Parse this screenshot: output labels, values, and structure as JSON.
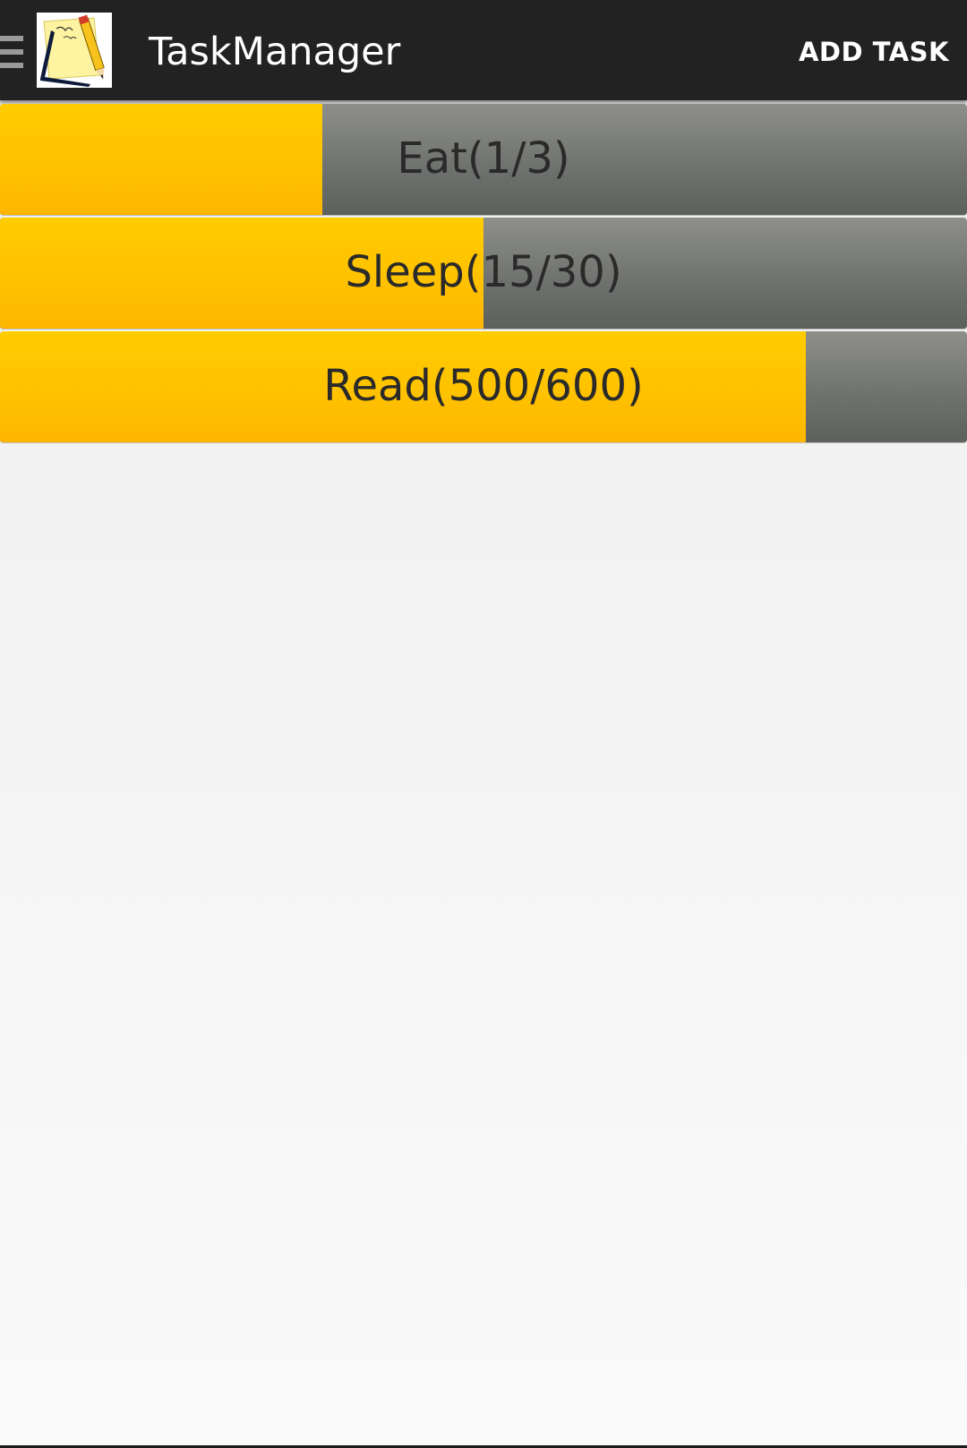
{
  "app": {
    "title": "TaskManager",
    "add_task_label": "ADD TASK"
  },
  "icons": {
    "drawer": "menu-icon",
    "app": "notepad-pencil-icon"
  },
  "colors": {
    "actionbar": "#222222",
    "progress_fill": "#ffc400",
    "progress_track": "#737671"
  },
  "tasks": [
    {
      "label": "Eat(1/3)",
      "done": 1,
      "total": 3
    },
    {
      "label": "Sleep(15/30)",
      "done": 15,
      "total": 30
    },
    {
      "label": "Read(500/600)",
      "done": 500,
      "total": 600
    }
  ]
}
